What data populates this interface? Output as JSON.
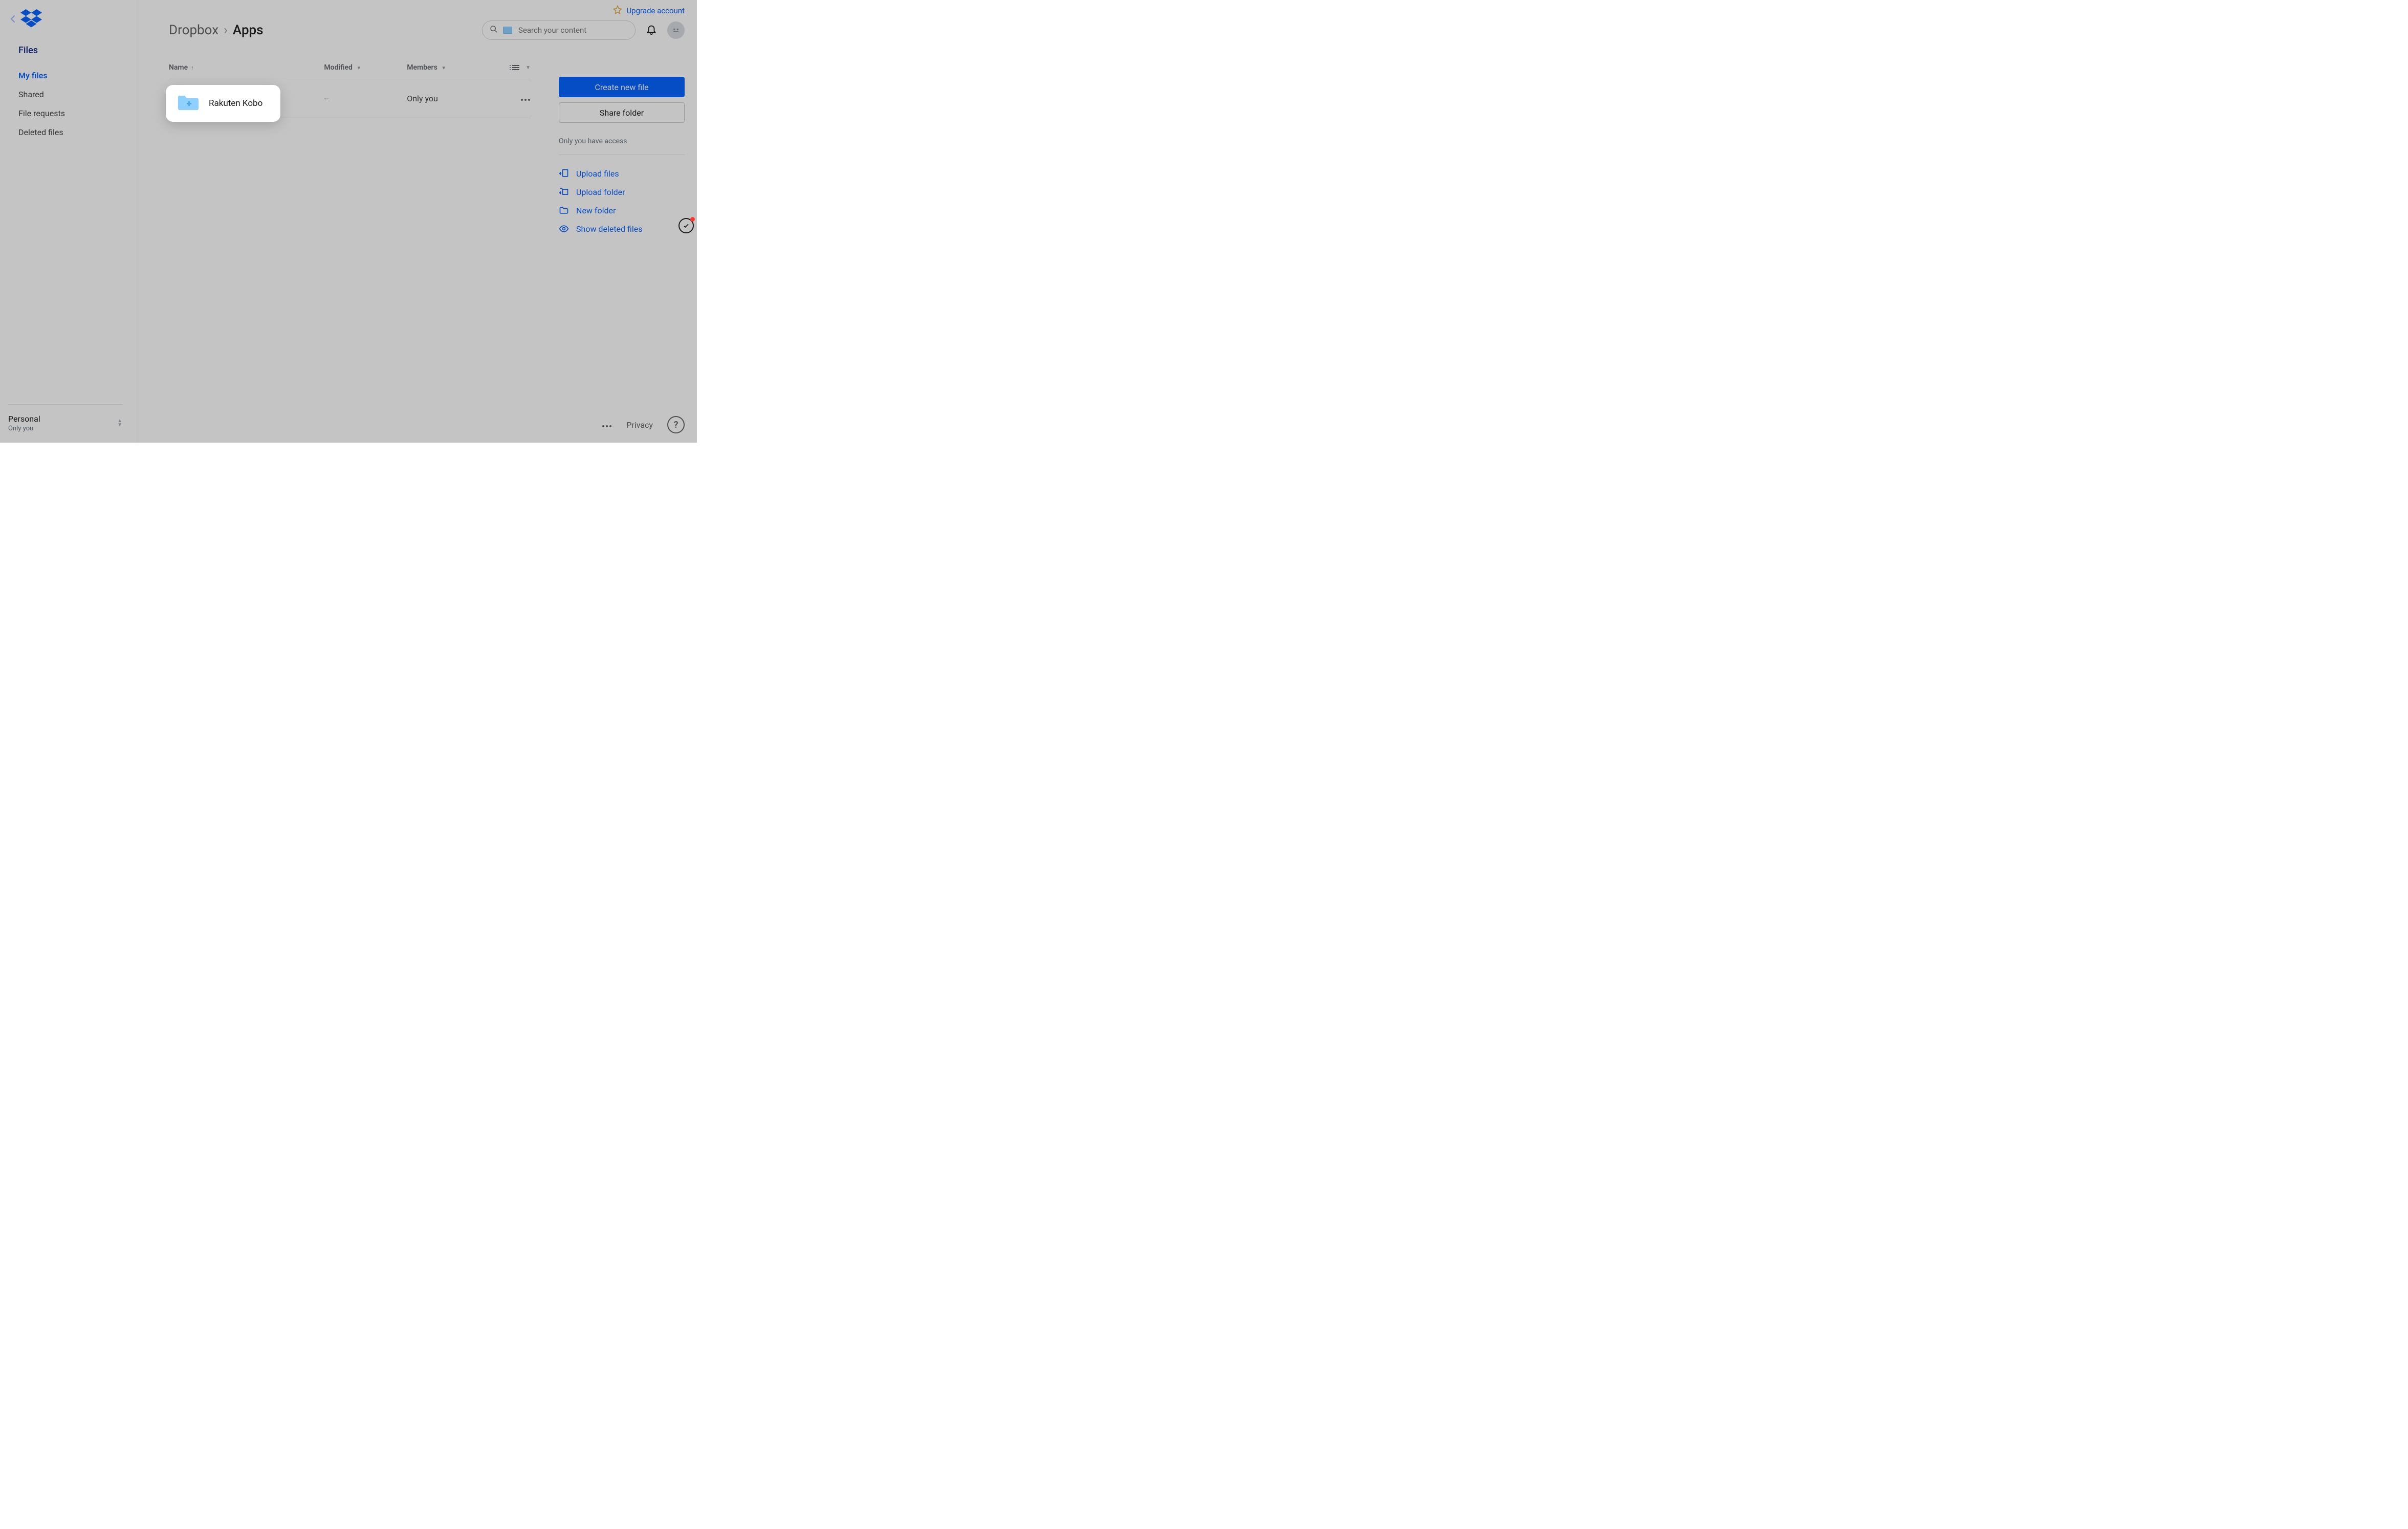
{
  "upgrade": {
    "label": "Upgrade account"
  },
  "sidebar": {
    "section": "Files",
    "items": [
      {
        "label": "My files",
        "active": true
      },
      {
        "label": "Shared"
      },
      {
        "label": "File requests"
      },
      {
        "label": "Deleted files"
      }
    ],
    "account": {
      "name": "Personal",
      "scope": "Only you"
    }
  },
  "breadcrumb": {
    "root": "Dropbox",
    "current": "Apps"
  },
  "search": {
    "placeholder": "Search your content"
  },
  "table": {
    "columns": {
      "name": "Name",
      "modified": "Modified",
      "members": "Members"
    },
    "rows": [
      {
        "name": "Rakuten Kobo",
        "modified": "--",
        "members": "Only you"
      }
    ]
  },
  "rightpanel": {
    "create": "Create new file",
    "share": "Share folder",
    "access_note": "Only you have access",
    "actions": [
      {
        "label": "Upload files"
      },
      {
        "label": "Upload folder"
      },
      {
        "label": "New folder"
      },
      {
        "label": "Show deleted files"
      }
    ]
  },
  "footer": {
    "privacy": "Privacy"
  }
}
